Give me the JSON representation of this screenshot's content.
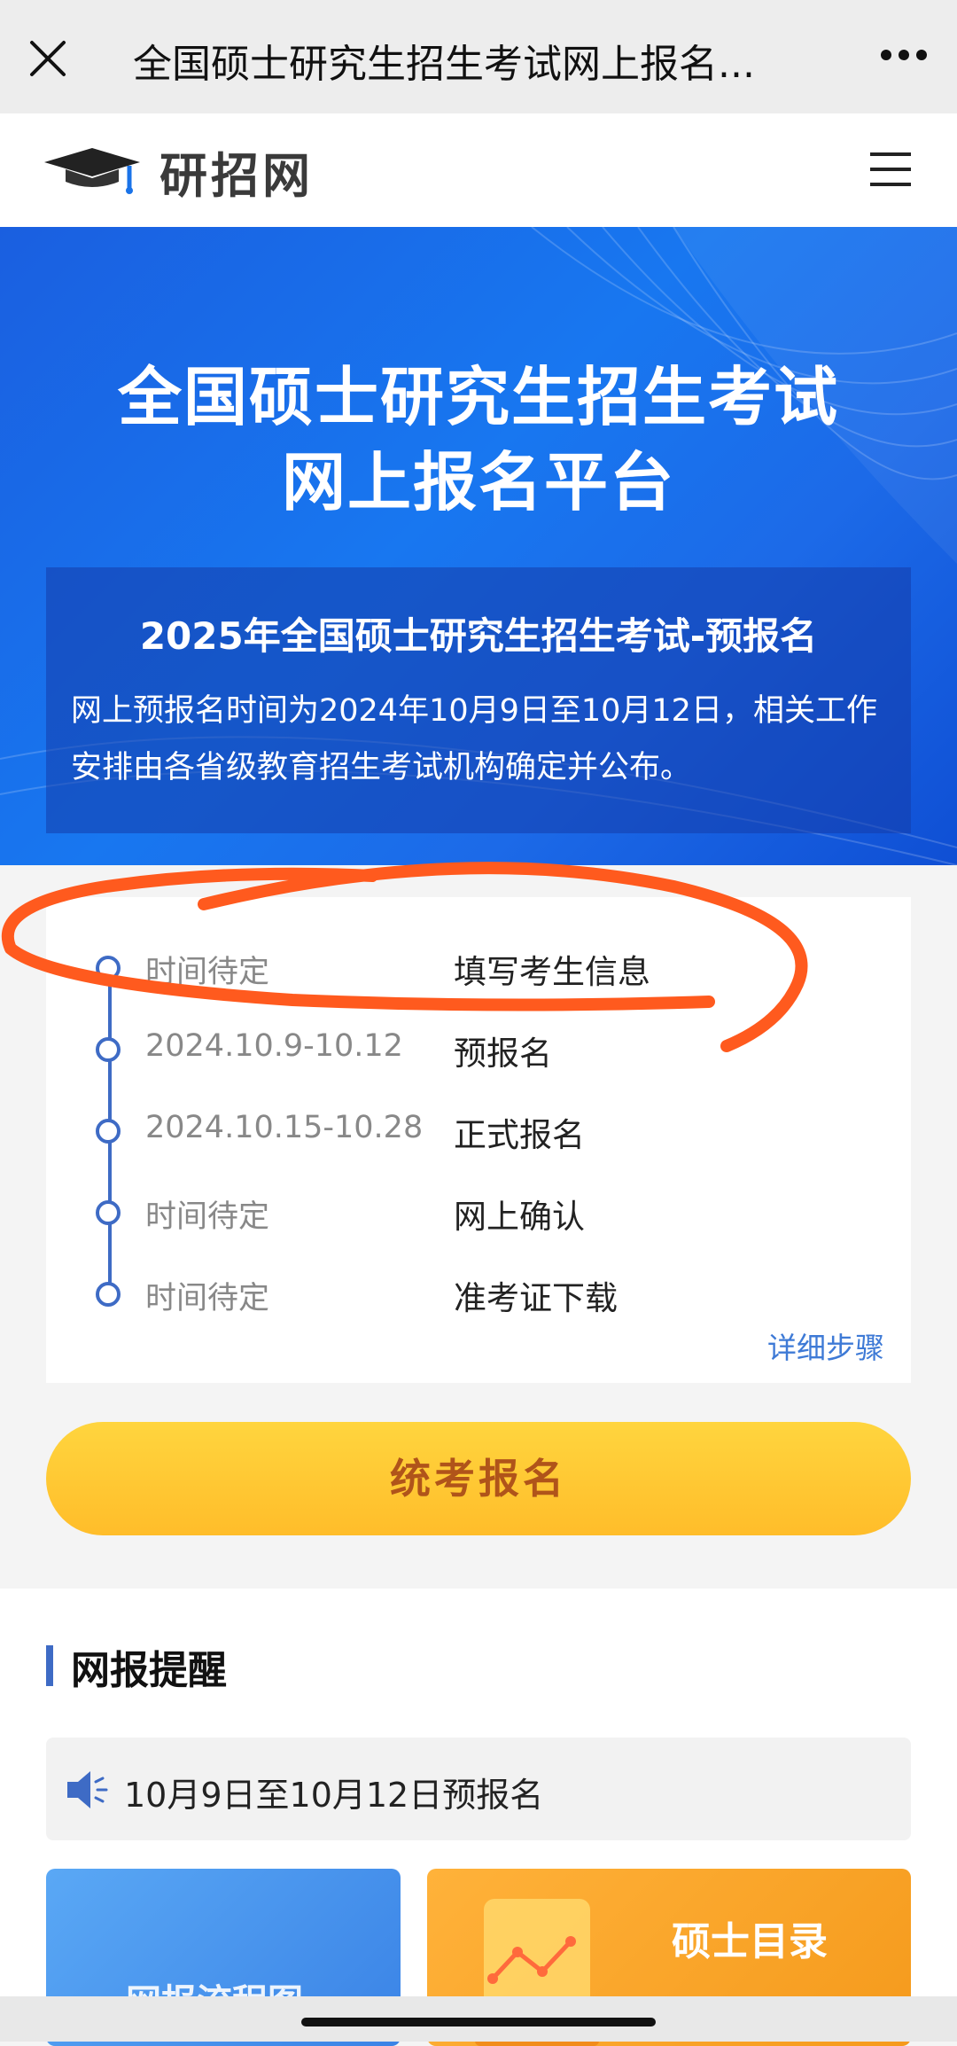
{
  "topbar": {
    "title": "全国硕士研究生招生考试网上报名..."
  },
  "header": {
    "logo_text": "研招网"
  },
  "banner": {
    "title_line1": "全国硕士研究生招生考试",
    "title_line2": "网上报名平台",
    "notice_title": "2025年全国硕士研究生招生考试-预报名",
    "notice_body": "网上预报名时间为2024年10月9日至10月12日，相关工作安排由各省级教育招生考试机构确定并公布。"
  },
  "timeline": {
    "items": [
      {
        "date": "时间待定",
        "step": "填写考生信息"
      },
      {
        "date": "2024.10.9-10.12",
        "step": "预报名"
      },
      {
        "date": "2024.10.15-10.28",
        "step": "正式报名"
      },
      {
        "date": "时间待定",
        "step": "网上确认"
      },
      {
        "date": "时间待定",
        "step": "准考证下载"
      }
    ],
    "detail_link": "详细步骤"
  },
  "apply_button": "统考报名",
  "reminders": {
    "section_title": "网报提醒",
    "notice": "10月9日至10月12日预报名",
    "tile_left_label": "网报流程图",
    "tile_right_label": "硕士目录"
  },
  "colors": {
    "accent_blue": "#3e6bc5",
    "banner_blue": "#1877f0",
    "button_yellow": "#ffc832",
    "annotation_orange": "#ff5a1e"
  }
}
